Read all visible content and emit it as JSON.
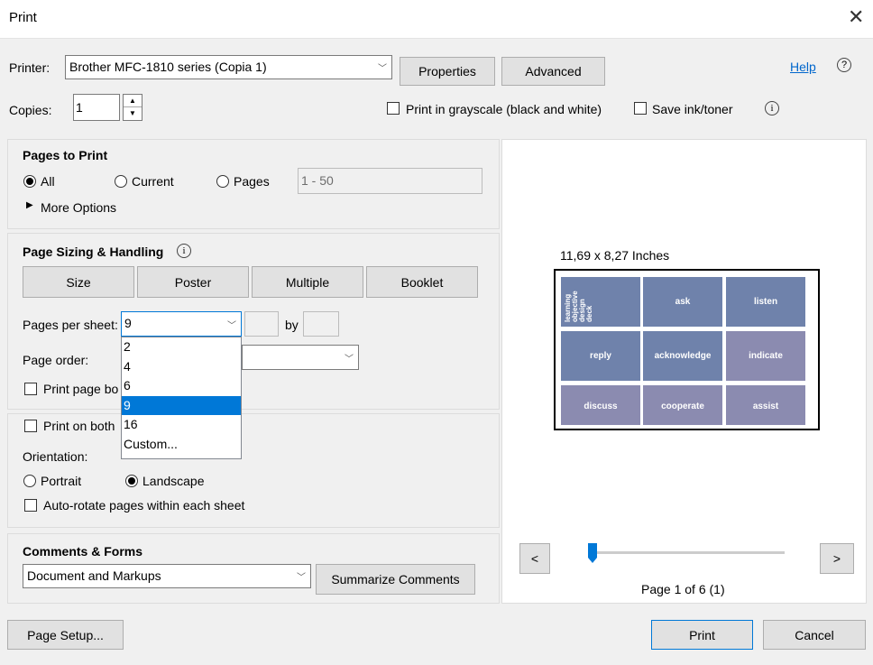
{
  "dialog": {
    "title": "Print"
  },
  "printer": {
    "label": "Printer:",
    "selected": "Brother MFC-1810 series (Copia 1)",
    "properties_label": "Properties",
    "advanced_label": "Advanced",
    "help_label": "Help"
  },
  "copies": {
    "label": "Copies:",
    "value": "1"
  },
  "options": {
    "grayscale_label": "Print in grayscale (black and white)",
    "grayscale_checked": false,
    "save_ink_label": "Save ink/toner",
    "save_ink_checked": false
  },
  "pages_to_print": {
    "heading": "Pages to Print",
    "all_label": "All",
    "current_label": "Current",
    "pages_label": "Pages",
    "pages_placeholder": "1 - 50",
    "selected": "All",
    "more_options_label": "More Options"
  },
  "sizing": {
    "heading": "Page Sizing & Handling",
    "tabs": [
      "Size",
      "Poster",
      "Multiple",
      "Booklet"
    ],
    "active_tab": "Multiple",
    "pages_per_sheet_label": "Pages per sheet:",
    "pages_per_sheet_value": "9",
    "by_label": "by",
    "page_order_label": "Page order:",
    "print_page_border_label": "Print page bo",
    "dropdown_options": [
      "2",
      "4",
      "6",
      "9",
      "16",
      "Custom..."
    ],
    "dropdown_selected": "9"
  },
  "orientation_panel": {
    "print_both_label": "Print on both",
    "orientation_label": "Orientation:",
    "portrait_label": "Portrait",
    "landscape_label": "Landscape",
    "selected": "Landscape",
    "autorotate_label": "Auto-rotate pages within each sheet"
  },
  "comments": {
    "heading": "Comments & Forms",
    "selected": "Document and Markups",
    "summarize_label": "Summarize Comments"
  },
  "preview": {
    "size_label": "11,69 x 8,27 Inches",
    "prev_label": "<",
    "next_label": ">",
    "page_label": "Page 1 of 6 (1)",
    "slider_position": 0.0,
    "cover_title_lines": [
      "learning",
      "objective",
      "design",
      "deck"
    ],
    "tiles": [
      {
        "word": "ask",
        "color": "#6f82ab"
      },
      {
        "word": "listen",
        "color": "#6f82ab"
      },
      {
        "word": "reply",
        "color": "#6f82ab"
      },
      {
        "word": "acknowledge",
        "color": "#6f82ab"
      },
      {
        "word": "indicate",
        "color": "#8b8bb0"
      },
      {
        "word": "discuss",
        "color": "#8b8bb0"
      },
      {
        "word": "cooperate",
        "color": "#8b8bb0"
      },
      {
        "word": "assist",
        "color": "#8b8bb0"
      }
    ]
  },
  "footer": {
    "page_setup_label": "Page Setup...",
    "print_label": "Print",
    "cancel_label": "Cancel"
  }
}
